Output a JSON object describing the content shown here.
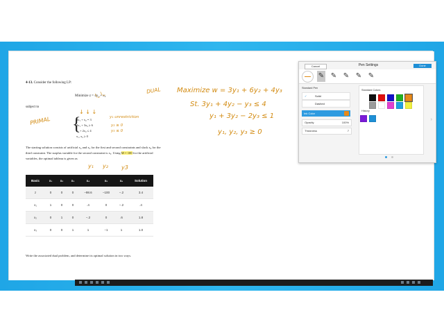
{
  "document": {
    "problem_number": "4-13.",
    "problem_text": "Consider the following LP:",
    "objective": "Minimize z = 4x₁ + x₂",
    "subject_to": "subject to",
    "constraints": [
      "3x₁ +    x₂ = 3",
      "4x₁ + 3x₂ ≥ 6",
      " x₁ + 2x₂ ≤ 4",
      "x₁, x₂ ≥ 0"
    ],
    "paragraph_pre": "The starting solution consists of artificial x₄ and x₅ for the first and second constraints and slack x₆ for the third constraint. The surplus variable for the second constraint is x₃. Using ",
    "paragraph_highlight": "M = 100",
    "paragraph_post": " for the artificial variables, the optimal tableau is given as",
    "table": {
      "headers": [
        "Basic",
        "x₁",
        "x₂",
        "x₃",
        "x₄",
        "x₅",
        "x₆",
        "Solution"
      ],
      "rows": [
        [
          "z",
          "0",
          "0",
          "0",
          "−98.6",
          "−100",
          "−.2",
          "3.4"
        ],
        [
          "x₁",
          "1",
          "0",
          "0",
          ".4",
          "0",
          "−.2",
          ".4"
        ],
        [
          "x₂",
          "0",
          "1",
          "0",
          "−.2",
          "0",
          ".6",
          "1.8"
        ],
        [
          "x₃",
          "0",
          "0",
          "1",
          "1",
          "−1",
          "1",
          "1.0"
        ]
      ]
    },
    "footer": "Write the associated dual problem, and determine its optimal solution in two ways."
  },
  "ink": {
    "dual": "DUAL",
    "primal": "PRIMAL",
    "maximize": "Maximize  w = 3y₁ + 6y₂ + 4y₃",
    "st": "St.  3y₁ + 4y₂ − y₃ ≤ 4",
    "c2": "y₁ + 3y₂ − 2y₃ ≤ 1",
    "nonneg": "y₁, y₂, y₃ ≥ 0",
    "y1_note": "y₁ unrestriction",
    "y2_note": "y₂ ≥ 0",
    "y3_note": "y₃ ≤ 0",
    "col_y1": "y₁",
    "col_y2": "y₂",
    "col_y3": "y3",
    "arrows": "↓   ↓  ↓"
  },
  "pen_settings": {
    "cancel": "Cancel",
    "title": "Pen Settings",
    "done": "Done",
    "standard_pen": "Standard Pen",
    "solid": "Solid",
    "dashed": "Dashed",
    "ink_color": "Ink Color",
    "opacity_label": "Opacity",
    "opacity_value": "100%",
    "thickness_label": "Thickness",
    "thickness_value": "7",
    "standard_colors": "Standard Colors",
    "history": "History",
    "colors": [
      "#111111",
      "#e01010",
      "#1414c8",
      "#22b022",
      "#e8891a",
      "#9a9a9a",
      "#ffffff",
      "#e040d0",
      "#1ea0e0",
      "#f0f040"
    ],
    "history_colors": [
      "#7a1ad8",
      "#1e8fd6"
    ]
  }
}
